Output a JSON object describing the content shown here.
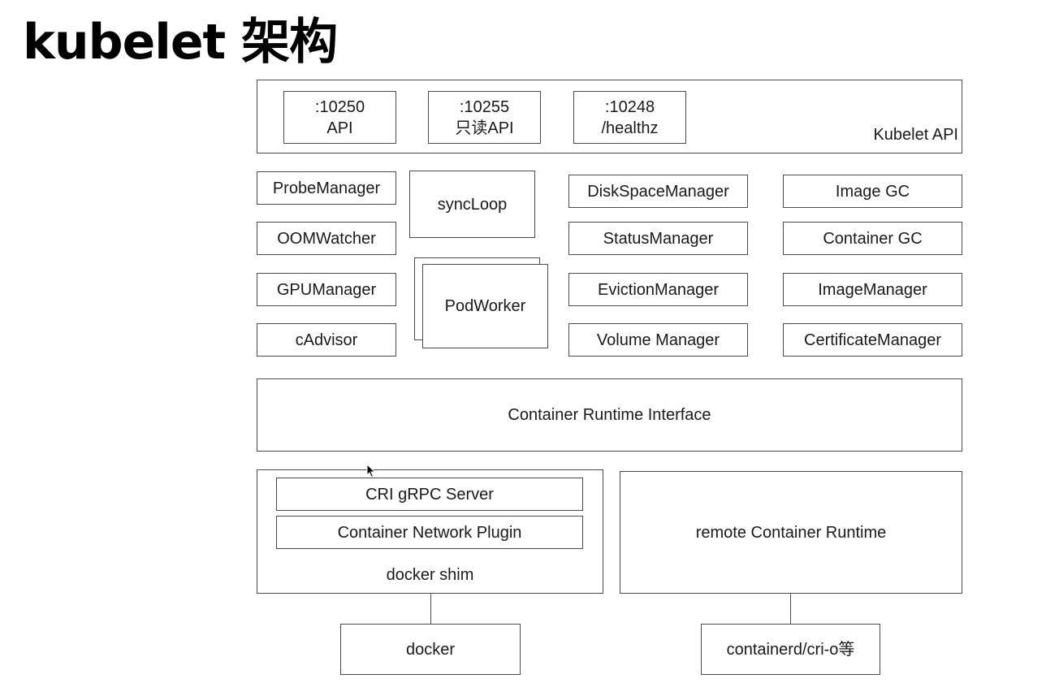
{
  "title": "kubelet 架构",
  "kubelet_api": {
    "label": "Kubelet API",
    "ports": [
      {
        "port": ":10250",
        "name": "API"
      },
      {
        "port": ":10255",
        "name": "只读API"
      },
      {
        "port": ":10248",
        "name": "/healthz"
      }
    ]
  },
  "components": {
    "left": [
      "ProbeManager",
      "OOMWatcher",
      "GPUManager",
      "cAdvisor"
    ],
    "sync_loop": "syncLoop",
    "pod_worker": "PodWorker",
    "middle": [
      "DiskSpaceManager",
      "StatusManager",
      "EvictionManager",
      "Volume Manager"
    ],
    "right": [
      "Image GC",
      "Container GC",
      "ImageManager",
      "CertificateManager"
    ]
  },
  "cri": "Container Runtime Interface",
  "docker_shim": {
    "label": "docker shim",
    "items": [
      "CRI gRPC Server",
      "Container Network Plugin"
    ]
  },
  "remote_runtime": "remote Container Runtime",
  "backends": {
    "docker": "docker",
    "containerd": "containerd/cri-o等"
  }
}
